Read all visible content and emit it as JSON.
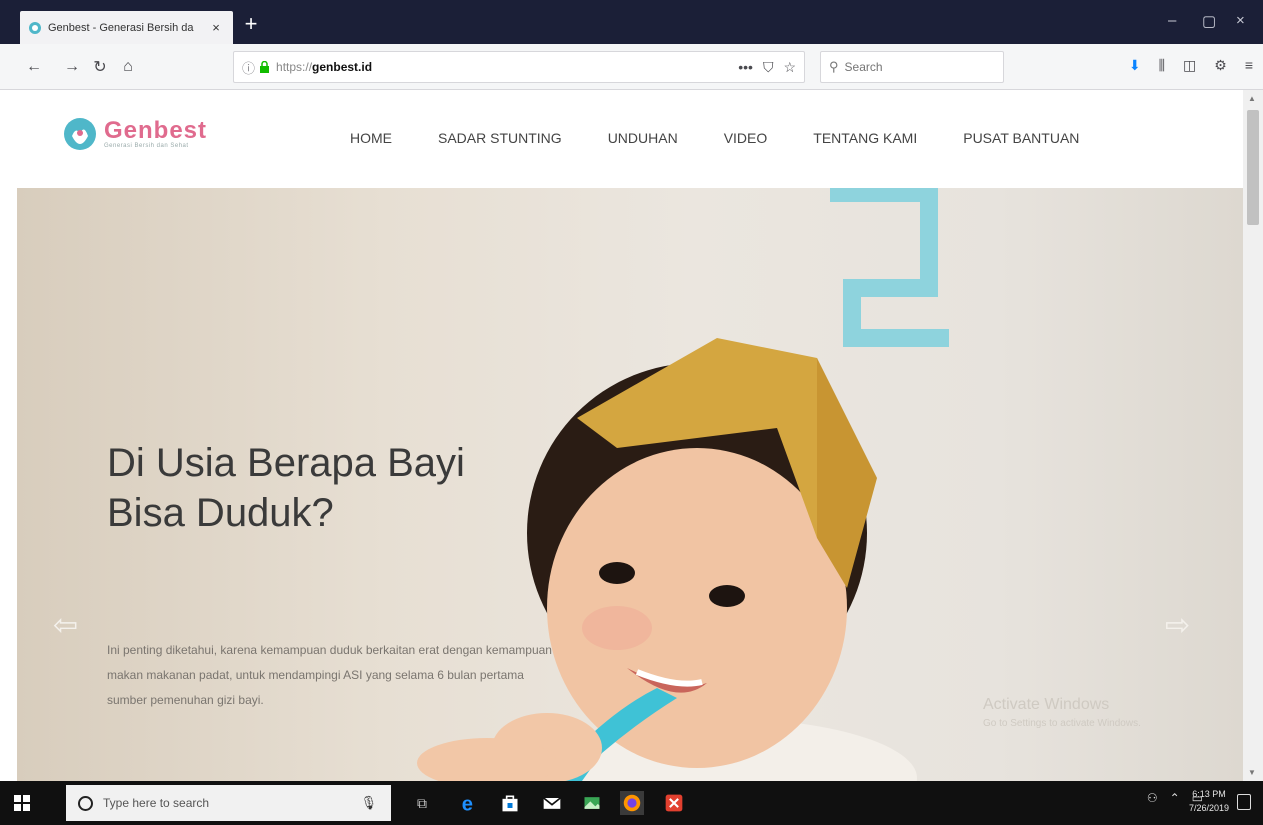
{
  "browser": {
    "tab_title": "Genbest - Generasi Bersih da",
    "tab_close": "×",
    "new_tab": "+",
    "window_controls": {
      "minimize": "–",
      "maximize": "▢",
      "close": "×"
    },
    "nav": {
      "back": "←",
      "forward": "→",
      "reload": "↻",
      "home": "⌂"
    },
    "url_scheme": "https://",
    "url_host": "genbest.id",
    "url_actions": [
      "•••",
      "⛉",
      "☆"
    ],
    "search_placeholder": "Search",
    "search_icon": "🔍",
    "toolbar_icons": [
      "download-icon",
      "library-icon",
      "sidebar-icon",
      "extension-icon",
      "menu-icon"
    ],
    "toolbar_glyphs": [
      "⬇",
      "⫼",
      "◫",
      "⚙",
      "≡"
    ]
  },
  "site": {
    "logo_name": "Genbest",
    "logo_tagline": "Generasi Bersih dan Sehat",
    "menu": [
      {
        "label": "HOME"
      },
      {
        "label": "SADAR STUNTING"
      },
      {
        "label": "UNDUHAN"
      },
      {
        "label": "VIDEO"
      },
      {
        "label": "TENTANG KAMI"
      },
      {
        "label": "PUSAT BANTUAN"
      }
    ]
  },
  "hero": {
    "title_line1": "Di Usia Berapa Bayi",
    "title_line2": "Bisa Duduk?",
    "text_line1": "Ini penting diketahui, karena kemampuan duduk berkaitan erat dengan kemampuan",
    "text_line2": "makan makanan padat, untuk mendampingi ASI yang selama 6 bulan pertama",
    "text_line3": "sumber pemenuhan gizi bayi.",
    "prev_arrow": "⇦",
    "next_arrow": "⇨",
    "watermark_title": "Activate Windows",
    "watermark_sub": "Go to Settings to activate Windows."
  },
  "taskbar": {
    "search_placeholder": "Type here to search",
    "time": "6:13 PM",
    "date": "7/26/2019"
  },
  "colors": {
    "tabstrip": "#1b1f37",
    "brand_pink": "#e06b8e",
    "brand_teal": "#4fb7c9",
    "taskbar": "#101010"
  }
}
